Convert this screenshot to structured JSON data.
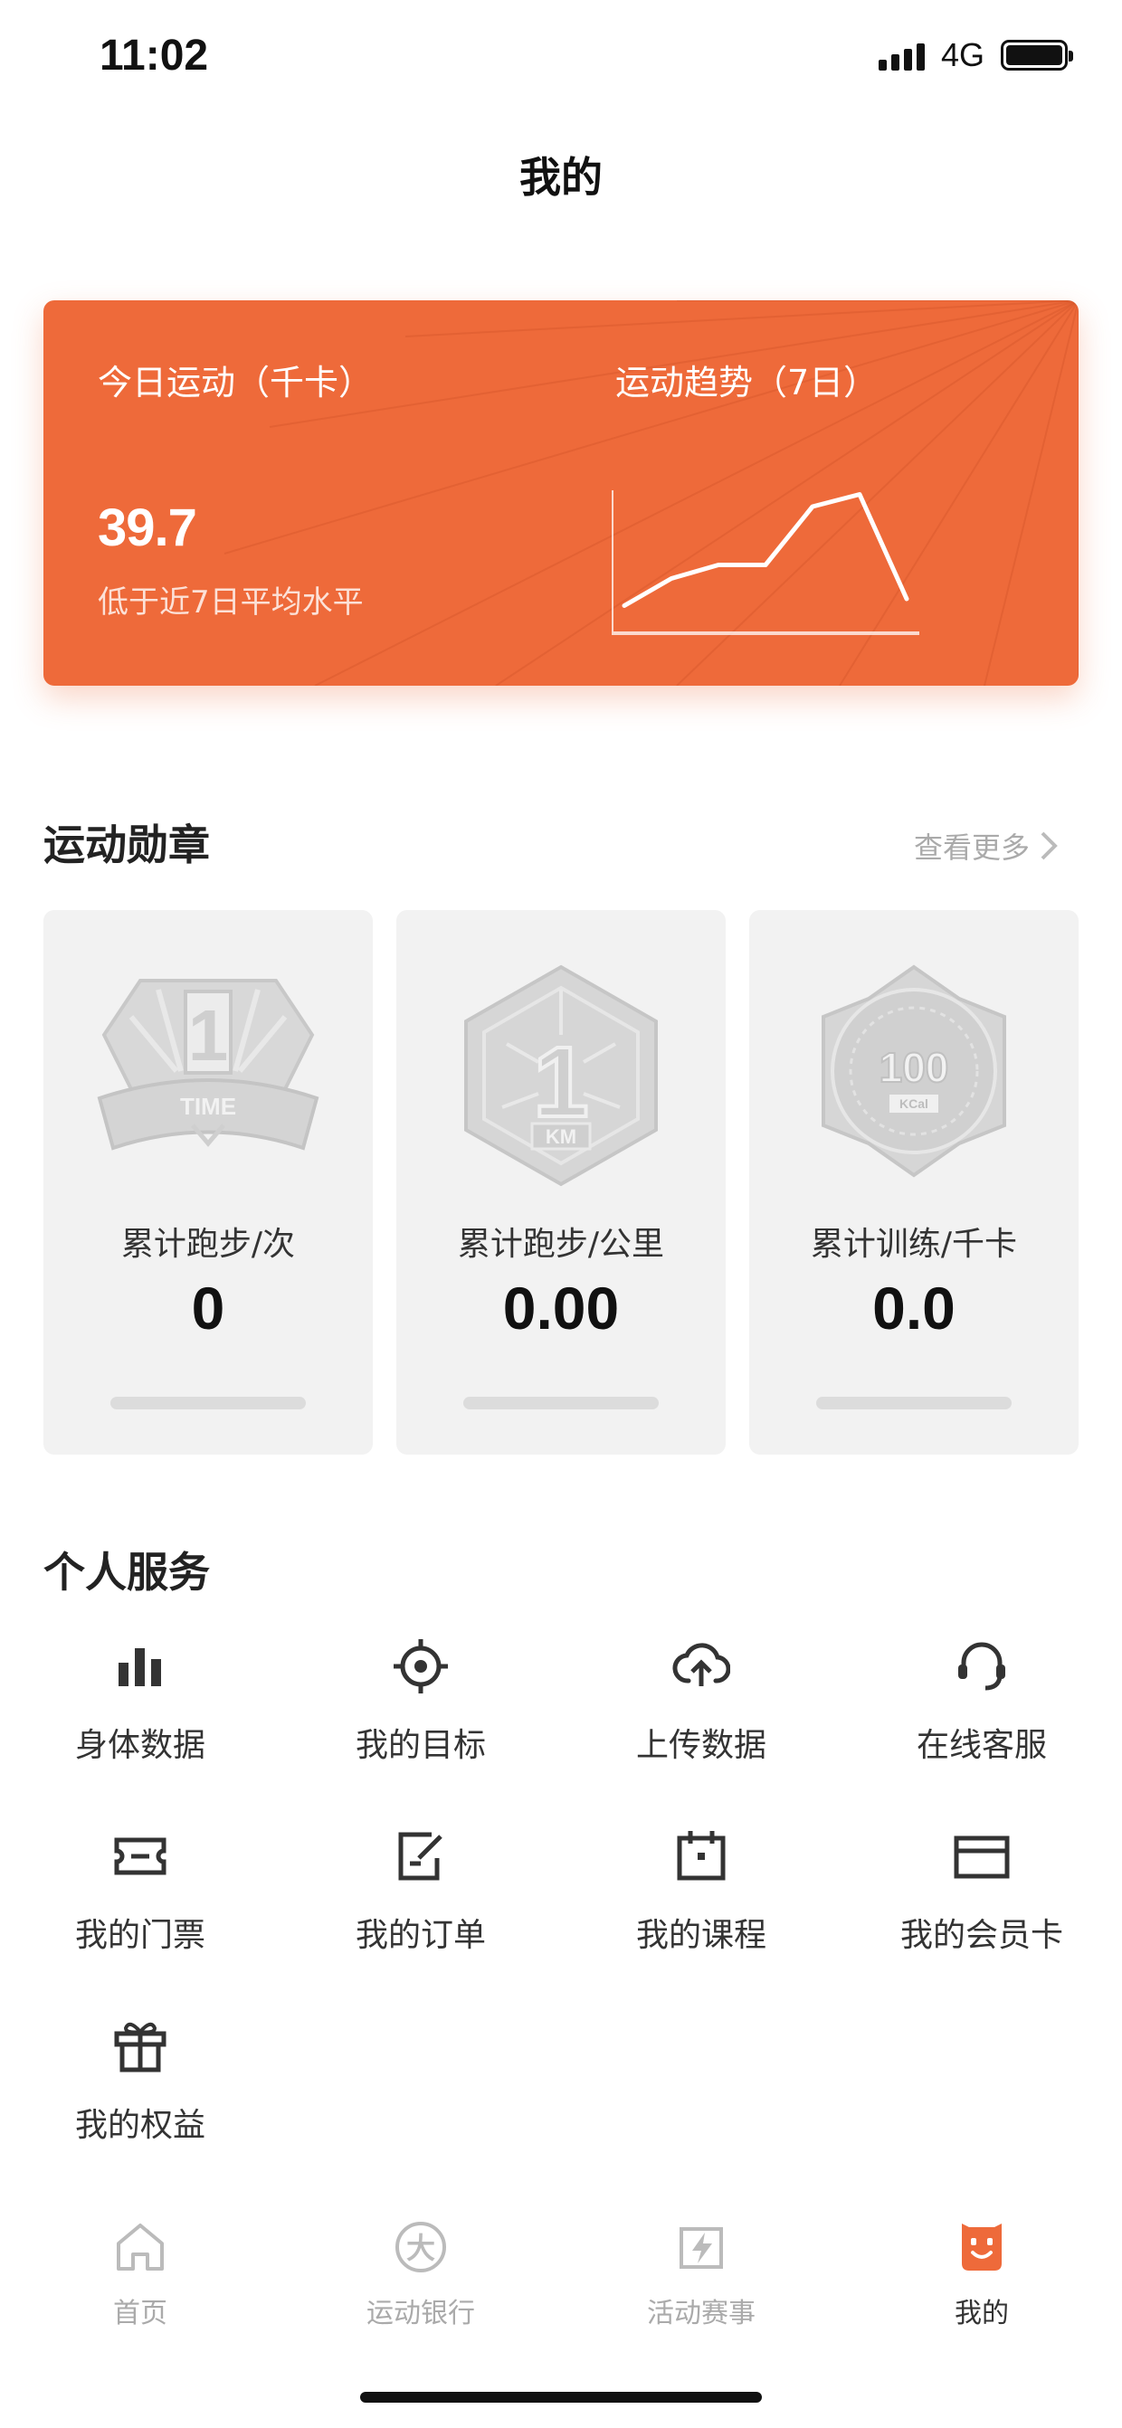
{
  "status_bar": {
    "time": "11:02",
    "network": "4G"
  },
  "page": {
    "title": "我的"
  },
  "summary_card": {
    "today_label": "今日运动（千卡）",
    "today_value": "39.7",
    "today_note": "低于近7日平均水平",
    "trend_label": "运动趋势（7日）",
    "trend_values": [
      0.15,
      0.35,
      0.45,
      0.45,
      0.88,
      0.97,
      0.2
    ],
    "accent_color": "#ee6a3a"
  },
  "medals": {
    "title": "运动勋章",
    "more_label": "查看更多",
    "items": [
      {
        "label": "累计跑步/次",
        "value": "0",
        "badge": "time-badge-icon"
      },
      {
        "label": "累计跑步/公里",
        "value": "0.00",
        "badge": "km-badge-icon"
      },
      {
        "label": "累计训练/千卡",
        "value": "0.0",
        "badge": "kcal-badge-icon"
      }
    ],
    "badges": {
      "time_text": "TIME",
      "km_text": "KM",
      "kcal_number": "100",
      "kcal_unit": "KCal"
    }
  },
  "services": {
    "title": "个人服务",
    "items": [
      {
        "label": "身体数据",
        "icon": "bar-chart-icon"
      },
      {
        "label": "我的目标",
        "icon": "target-icon"
      },
      {
        "label": "上传数据",
        "icon": "cloud-upload-icon"
      },
      {
        "label": "在线客服",
        "icon": "headset-icon"
      },
      {
        "label": "我的门票",
        "icon": "ticket-icon"
      },
      {
        "label": "我的订单",
        "icon": "order-edit-icon"
      },
      {
        "label": "我的课程",
        "icon": "calendar-icon"
      },
      {
        "label": "我的会员卡",
        "icon": "card-icon"
      },
      {
        "label": "我的权益",
        "icon": "gift-icon"
      }
    ]
  },
  "tab_bar": {
    "items": [
      {
        "label": "首页",
        "icon": "home-icon",
        "active": false
      },
      {
        "label": "运动银行",
        "icon": "sport-bank-icon",
        "active": false
      },
      {
        "label": "活动赛事",
        "icon": "events-icon",
        "active": false
      },
      {
        "label": "我的",
        "icon": "profile-icon",
        "active": true
      }
    ],
    "active_color": "#ee6a3a",
    "inactive_color": "#bbbbbb"
  }
}
